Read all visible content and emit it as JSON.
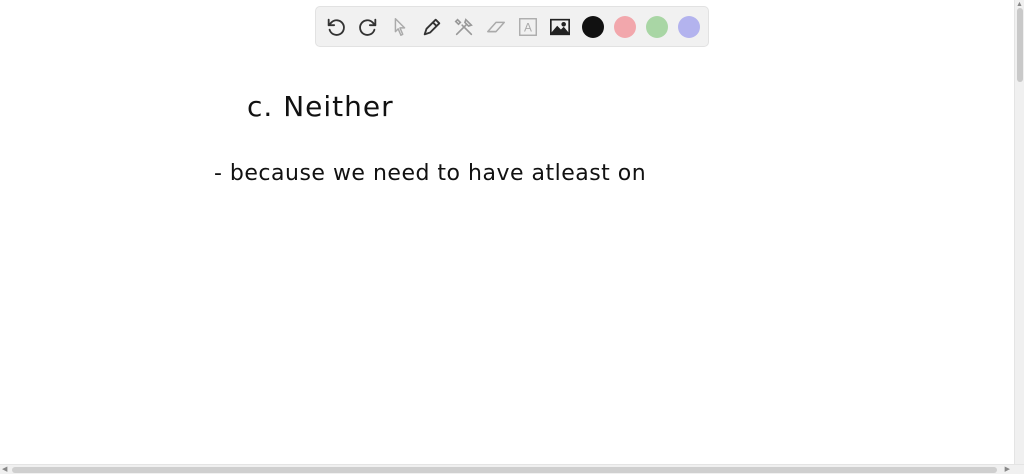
{
  "toolbar": {
    "tools": [
      {
        "name": "undo-icon"
      },
      {
        "name": "redo-icon"
      },
      {
        "name": "pointer-icon"
      },
      {
        "name": "pen-icon"
      },
      {
        "name": "tools-icon"
      },
      {
        "name": "eraser-icon"
      },
      {
        "name": "text-icon"
      },
      {
        "name": "image-icon"
      }
    ],
    "text_tool_glyph": "A",
    "colors": {
      "black": "#111111",
      "red": "#f2a7ac",
      "green": "#a9d6a5",
      "blue": "#b3b3ee"
    }
  },
  "canvas": {
    "lines": [
      "c.  Neither",
      "- because  we  need  to  have  atleast  on"
    ]
  },
  "scrollbars": {
    "up_arrow": "▲",
    "left_arrow": "◀",
    "right_arrow": "▶"
  }
}
